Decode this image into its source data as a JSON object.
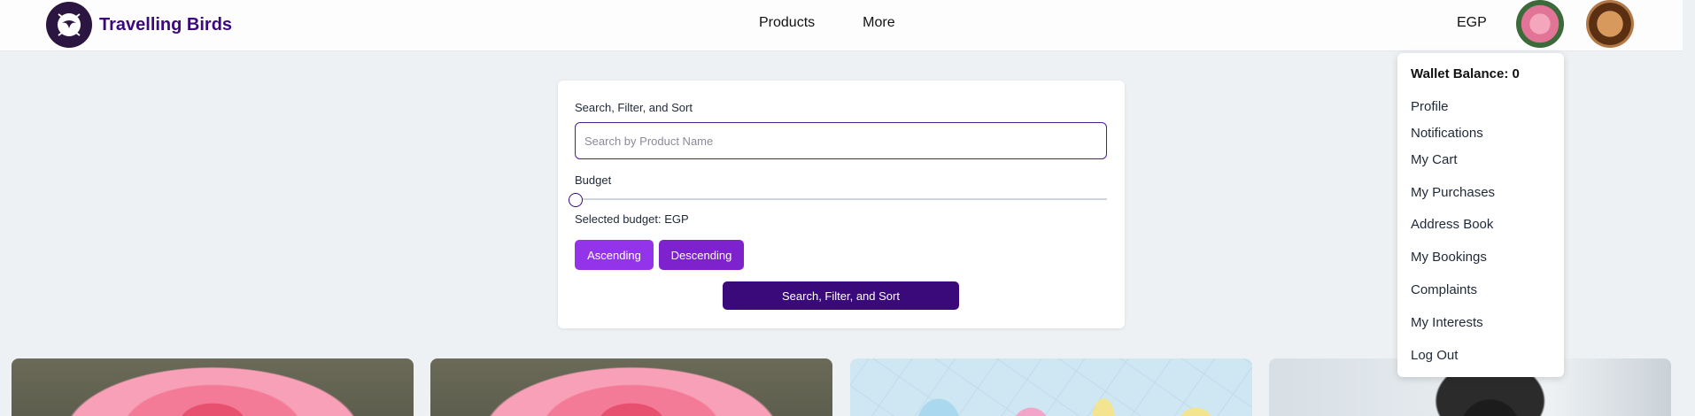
{
  "brand": {
    "name": "Travelling Birds",
    "logo_icon": "bird-globe-logo-icon"
  },
  "nav": {
    "items": [
      {
        "label": "Products"
      },
      {
        "label": "More"
      }
    ]
  },
  "header": {
    "currency": "EGP"
  },
  "search_card": {
    "search_label": "Search, Filter, and Sort",
    "search_placeholder": "Search by Product Name",
    "search_value": "",
    "budget_label": "Budget",
    "budget_level": 0,
    "selected_budget_text": "Selected budget: EGP",
    "ascending_label": "Ascending",
    "descending_label": "Descending",
    "submit_label": "Search, Filter, and Sort"
  },
  "profile_menu": {
    "wallet_balance": "Wallet Balance: 0",
    "items": [
      {
        "label": "Profile"
      },
      {
        "label": "Notifications"
      },
      {
        "label": "My Cart"
      },
      {
        "label": "My Purchases"
      },
      {
        "label": "Address Book"
      },
      {
        "label": "My Bookings"
      },
      {
        "label": "Complaints"
      },
      {
        "label": "My Interests"
      },
      {
        "label": "Log Out"
      }
    ]
  },
  "colors": {
    "brand": "#3b0a7a",
    "ascending_button": "#9333ea",
    "descending_button": "#7e22ce",
    "submit_button": "#3b0a7a",
    "page_background": "#eef1f4"
  },
  "products": [
    {
      "image": "pink-rose-photo"
    },
    {
      "image": "pink-rose-photo"
    },
    {
      "image": "pastel-balloons-photo"
    },
    {
      "image": "woman-with-camera-photo"
    }
  ]
}
